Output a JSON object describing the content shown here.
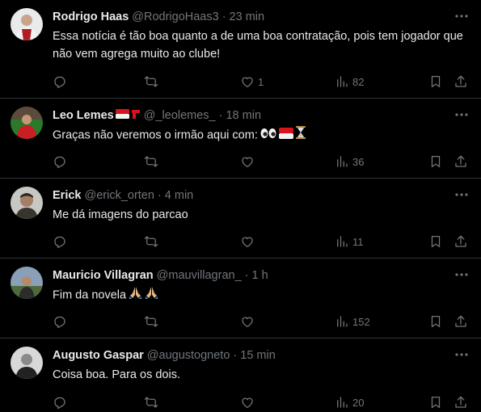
{
  "tweets": [
    {
      "name": "Rodrigo Haas",
      "handle": "@RodrigoHaas3",
      "dot": "·",
      "time": "23 min",
      "text": "Essa notícia é tão boa quanto a de uma boa contratação, pois tem jogador que não vem agrega muito ao clube!",
      "likes": "1",
      "views": "82",
      "avatar_colors": [
        "#c9ccd1",
        "#b01e23"
      ]
    },
    {
      "name": "Leo Lemes",
      "handle": "@_leolemes_",
      "dot": "·",
      "time": "18 min",
      "text": "Graças não veremos o irmão aqui com:",
      "likes": "",
      "views": "36",
      "avatar_colors": [
        "#2a7a2a",
        "#c81e24"
      ]
    },
    {
      "name": "Erick",
      "handle": "@erick_orten",
      "dot": "·",
      "time": "4 min",
      "text": "Me dá imagens do parcao",
      "likes": "",
      "views": "11",
      "avatar_colors": [
        "#c7c7c3",
        "#3a342e"
      ]
    },
    {
      "name": "Mauricio Villagran",
      "handle": "@mauvillagran_",
      "dot": "·",
      "time": "1 h",
      "text": "Fim da novela",
      "likes": "",
      "views": "152",
      "avatar_colors": [
        "#8aa0b8",
        "#4e6a3a"
      ]
    },
    {
      "name": "Augusto Gaspar",
      "handle": "@augustogneto",
      "dot": "·",
      "time": "15 min",
      "text": "Coisa boa. Para os dois.",
      "likes": "",
      "views": "20",
      "avatar_colors": [
        "#d8d8d8",
        "#222222"
      ]
    }
  ],
  "icons": {
    "more": "more-icon",
    "reply": "reply-icon",
    "retweet": "retweet-icon",
    "like": "heart-icon",
    "views": "views-icon",
    "bookmark": "bookmark-icon",
    "share": "share-icon"
  },
  "colors": {
    "background": "#000000",
    "text": "#e7e9ea",
    "secondary": "#71767b",
    "divider": "#2f3336"
  }
}
